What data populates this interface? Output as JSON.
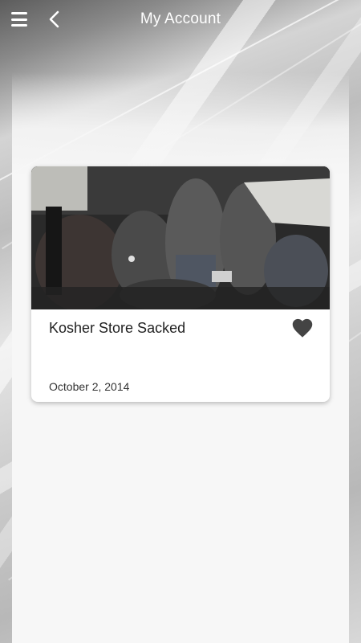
{
  "header": {
    "title": "My Account",
    "menu_icon": "hamburger-menu-icon",
    "back_icon": "chevron-left-icon"
  },
  "articles": [
    {
      "title": "Kosher Store Sacked",
      "date": "October 2, 2014",
      "favorite_icon": "heart-icon",
      "favorited": true
    }
  ],
  "colors": {
    "header_text": "#ffffff",
    "panel_bg": "#f7f7f7",
    "card_bg": "#ffffff",
    "heart": "#444444"
  }
}
